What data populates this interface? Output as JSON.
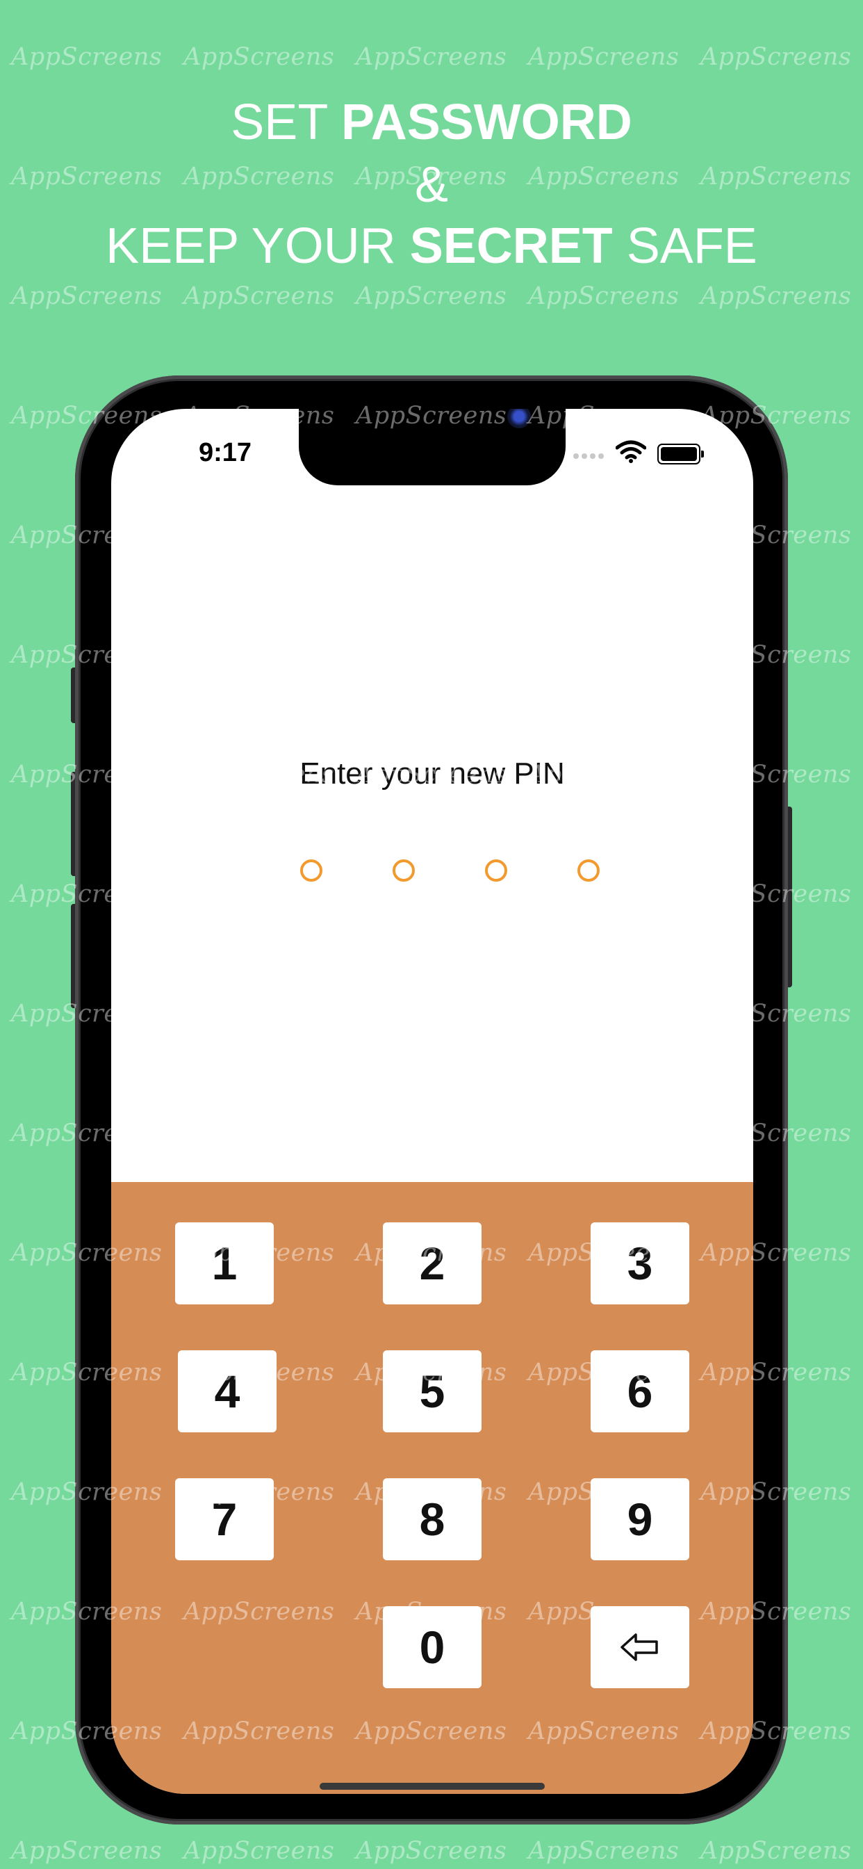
{
  "watermark": "AppScreens",
  "headline": {
    "line1_regular": "SET",
    "line1_bold": "PASSWORD",
    "line2": "&",
    "line3_regular_a": "KEEP YOUR",
    "line3_bold": "SECRET",
    "line3_regular_b": "SAFE"
  },
  "status_bar": {
    "time": "9:17"
  },
  "pin_screen": {
    "title": "Enter your new PIN",
    "pin_length": 4,
    "digits_entered": 0
  },
  "keypad": {
    "keys": [
      "1",
      "2",
      "3",
      "4",
      "5",
      "6",
      "7",
      "8",
      "9",
      "0"
    ],
    "backspace_icon": "backspace-arrow-icon"
  },
  "colors": {
    "background": "#74d99b",
    "keypad": "#d68c55",
    "pin_dot": "#f29a2e"
  }
}
